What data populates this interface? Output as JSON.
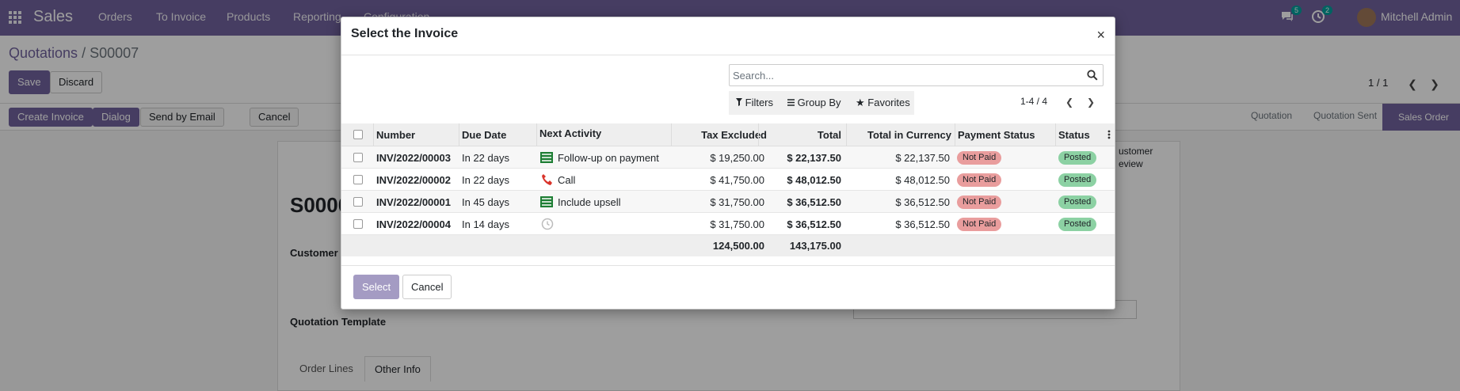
{
  "navbar": {
    "app_name": "Sales",
    "menu": [
      "Orders",
      "To Invoice",
      "Products",
      "Reporting",
      "Configuration"
    ],
    "messages_count": "5",
    "activities_count": "2",
    "user_name": "Mitchell Admin"
  },
  "control_panel": {
    "breadcrumb_parent": "Quotations",
    "breadcrumb_sep": "/",
    "breadcrumb_current": "S00007",
    "save_label": "Save",
    "discard_label": "Discard",
    "pager": "1 / 1"
  },
  "statusbar": {
    "buttons": [
      "Create Invoice",
      "Dialog",
      "Send by Email",
      "Cancel"
    ],
    "steps": [
      "Quotation",
      "Quotation Sent",
      "Sales Order"
    ]
  },
  "form_background": {
    "record_name": "S0000",
    "customer_label": "Customer",
    "quotation_template_label": "Quotation Template",
    "customer_preview": "ustomer",
    "customer_preview2": "eview",
    "tabs": [
      "Order Lines",
      "Other Info"
    ]
  },
  "dialog": {
    "title": "Select the Invoice",
    "close_glyph": "×",
    "search_placeholder": "Search...",
    "filters_label": "Filters",
    "group_by_label": "Group By",
    "favorites_label": "Favorites",
    "pager": "1-4 / 4",
    "columns": [
      "Number",
      "Due Date",
      "Next Activity",
      "Tax Excluded",
      "Total",
      "Total in Currency",
      "Payment Status",
      "Status"
    ],
    "rows": [
      {
        "number": "INV/2022/00003",
        "due": "In 22 days",
        "activity_icon": "todo-icon",
        "activity": "Follow-up on payment",
        "tax_excluded": "$ 19,250.00",
        "total": "$ 22,137.50",
        "total_currency": "$ 22,137.50",
        "payment_status": "Not Paid",
        "status": "Posted"
      },
      {
        "number": "INV/2022/00002",
        "due": "In 22 days",
        "activity_icon": "phone-icon",
        "activity": "Call",
        "tax_excluded": "$ 41,750.00",
        "total": "$ 48,012.50",
        "total_currency": "$ 48,012.50",
        "payment_status": "Not Paid",
        "status": "Posted"
      },
      {
        "number": "INV/2022/00001",
        "due": "In 45 days",
        "activity_icon": "todo-icon",
        "activity": "Include upsell",
        "tax_excluded": "$ 31,750.00",
        "total": "$ 36,512.50",
        "total_currency": "$ 36,512.50",
        "payment_status": "Not Paid",
        "status": "Posted"
      },
      {
        "number": "INV/2022/00004",
        "due": "In 14 days",
        "activity_icon": "clock-icon",
        "activity": "",
        "tax_excluded": "$ 31,750.00",
        "total": "$ 36,512.50",
        "total_currency": "$ 36,512.50",
        "payment_status": "Not Paid",
        "status": "Posted"
      }
    ],
    "totals": {
      "tax_excluded": "124,500.00",
      "total": "143,175.00"
    },
    "select_label": "Select",
    "cancel_label": "Cancel"
  },
  "colors": {
    "brand": "#71639e",
    "not_paid": "#e99d9d",
    "posted": "#8cd1a3"
  }
}
